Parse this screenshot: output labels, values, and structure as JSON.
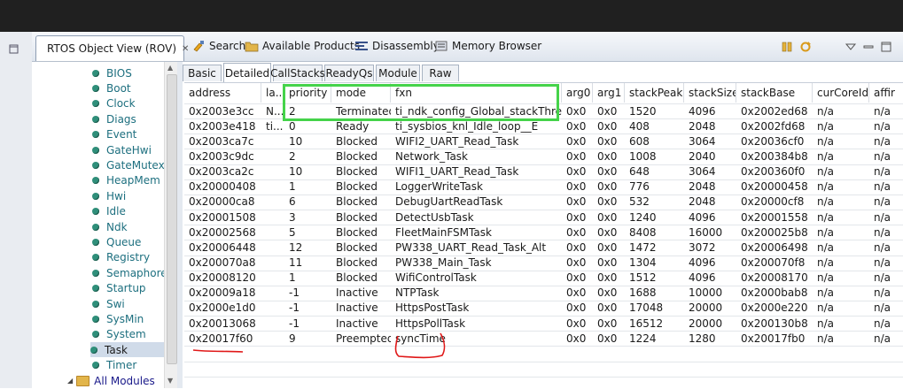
{
  "view": {
    "title": "RTOS Object View (ROV)",
    "close_glyph": "✕"
  },
  "toolbar": [
    {
      "label": "Search",
      "icon": "search-icon"
    },
    {
      "label": "Available Products",
      "icon": "products-icon"
    },
    {
      "label": "Disassembly",
      "icon": "disassembly-icon"
    },
    {
      "label": "Memory Browser",
      "icon": "memory-icon"
    }
  ],
  "tree": {
    "items": [
      "BIOS",
      "Boot",
      "Clock",
      "Diags",
      "Event",
      "GateHwi",
      "GateMutex",
      "HeapMem",
      "Hwi",
      "Idle",
      "Ndk",
      "Queue",
      "Registry",
      "Semaphore",
      "Startup",
      "Swi",
      "SysMin",
      "System",
      "Task",
      "Timer"
    ],
    "selected": "Task",
    "all_modules": "All Modules"
  },
  "tabs": [
    "Basic",
    "Detailed",
    "CallStacks",
    "ReadyQs",
    "Module",
    "Raw"
  ],
  "active_tab": "Detailed",
  "table": {
    "columns": [
      "address",
      "la...",
      "priority",
      "mode",
      "fxn",
      "arg0",
      "arg1",
      "stackPeak",
      "stackSize",
      "stackBase",
      "curCoreId",
      "affir"
    ],
    "rows": [
      [
        "0x2003e3cc",
        "N...",
        "2",
        "Terminated",
        "ti_ndk_config_Global_stackThread",
        "0x0",
        "0x0",
        "1520",
        "4096",
        "0x2002ed68",
        "n/a",
        "n/a"
      ],
      [
        "0x2003e418",
        "ti...",
        "0",
        "Ready",
        "ti_sysbios_knl_Idle_loop__E",
        "0x0",
        "0x0",
        "408",
        "2048",
        "0x2002fd68",
        "n/a",
        "n/a"
      ],
      [
        "0x2003ca7c",
        "",
        "10",
        "Blocked",
        "WIFI2_UART_Read_Task",
        "0x0",
        "0x0",
        "608",
        "3064",
        "0x20036cf0",
        "n/a",
        "n/a"
      ],
      [
        "0x2003c9dc",
        "",
        "2",
        "Blocked",
        "Network_Task",
        "0x0",
        "0x0",
        "1008",
        "2040",
        "0x200384b8",
        "n/a",
        "n/a"
      ],
      [
        "0x2003ca2c",
        "",
        "10",
        "Blocked",
        "WIFI1_UART_Read_Task",
        "0x0",
        "0x0",
        "648",
        "3064",
        "0x200360f0",
        "n/a",
        "n/a"
      ],
      [
        "0x20000408",
        "",
        "1",
        "Blocked",
        "LoggerWriteTask",
        "0x0",
        "0x0",
        "776",
        "2048",
        "0x20000458",
        "n/a",
        "n/a"
      ],
      [
        "0x20000ca8",
        "",
        "6",
        "Blocked",
        "DebugUartReadTask",
        "0x0",
        "0x0",
        "532",
        "2048",
        "0x20000cf8",
        "n/a",
        "n/a"
      ],
      [
        "0x20001508",
        "",
        "3",
        "Blocked",
        "DetectUsbTask",
        "0x0",
        "0x0",
        "1240",
        "4096",
        "0x20001558",
        "n/a",
        "n/a"
      ],
      [
        "0x20002568",
        "",
        "5",
        "Blocked",
        "FleetMainFSMTask",
        "0x0",
        "0x0",
        "8408",
        "16000",
        "0x200025b8",
        "n/a",
        "n/a"
      ],
      [
        "0x20006448",
        "",
        "12",
        "Blocked",
        "PW338_UART_Read_Task_Alt",
        "0x0",
        "0x0",
        "1472",
        "3072",
        "0x20006498",
        "n/a",
        "n/a"
      ],
      [
        "0x200070a8",
        "",
        "11",
        "Blocked",
        "PW338_Main_Task",
        "0x0",
        "0x0",
        "1304",
        "4096",
        "0x200070f8",
        "n/a",
        "n/a"
      ],
      [
        "0x20008120",
        "",
        "1",
        "Blocked",
        "WifiControlTask",
        "0x0",
        "0x0",
        "1512",
        "4096",
        "0x20008170",
        "n/a",
        "n/a"
      ],
      [
        "0x20009a18",
        "",
        "-1",
        "Inactive",
        "NTPTask",
        "0x0",
        "0x0",
        "1688",
        "10000",
        "0x2000bab8",
        "n/a",
        "n/a"
      ],
      [
        "0x2000e1d0",
        "",
        "-1",
        "Inactive",
        "HttpsPostTask",
        "0x0",
        "0x0",
        "17048",
        "20000",
        "0x2000e220",
        "n/a",
        "n/a"
      ],
      [
        "0x20013068",
        "",
        "-1",
        "Inactive",
        "HttpsPollTask",
        "0x0",
        "0x0",
        "16512",
        "20000",
        "0x200130b8",
        "n/a",
        "n/a"
      ],
      [
        "0x20017f60",
        "",
        "9",
        "Preempted",
        "syncTime",
        "0x0",
        "0x0",
        "1224",
        "1280",
        "0x20017fb0",
        "n/a",
        "n/a"
      ]
    ]
  },
  "colors": {
    "highlight_box": "#45d34a",
    "annotation_ink": "#e01818",
    "tree_text": "#1d6f7f"
  }
}
